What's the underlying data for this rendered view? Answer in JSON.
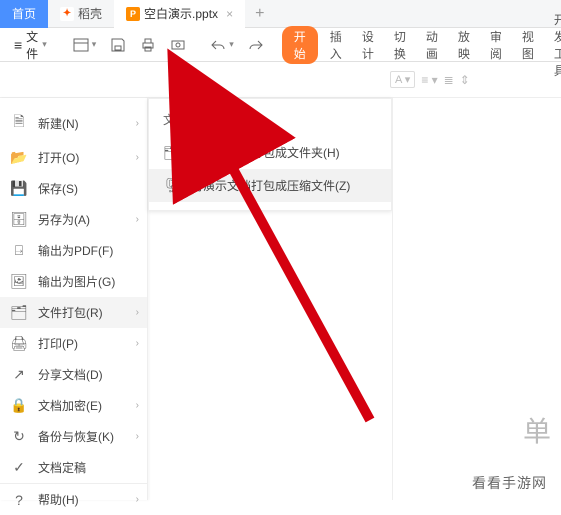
{
  "tabs": {
    "home": "首页",
    "dk": "稻壳",
    "doc": "空白演示.pptx"
  },
  "toolbar": {
    "file": "文件",
    "start_pill": "开始",
    "ribbon": [
      "插入",
      "设计",
      "切换",
      "动画",
      "放映",
      "审阅",
      "视图",
      "开发工具"
    ]
  },
  "file_menu": {
    "items": [
      {
        "label": "新建(N)",
        "icon": "new",
        "arrow": true
      },
      {
        "label": "打开(O)",
        "icon": "open",
        "arrow": true
      },
      {
        "label": "保存(S)",
        "icon": "save",
        "arrow": false
      },
      {
        "label": "另存为(A)",
        "icon": "saveas",
        "arrow": true
      },
      {
        "label": "输出为PDF(F)",
        "icon": "pdf",
        "arrow": false
      },
      {
        "label": "输出为图片(G)",
        "icon": "img",
        "arrow": false
      },
      {
        "label": "文件打包(R)",
        "icon": "pack",
        "arrow": true,
        "highlight": true
      },
      {
        "label": "打印(P)",
        "icon": "print",
        "arrow": true
      },
      {
        "label": "分享文档(D)",
        "icon": "share",
        "arrow": false
      },
      {
        "label": "文档加密(E)",
        "icon": "lock",
        "arrow": true
      },
      {
        "label": "备份与恢复(K)",
        "icon": "backup",
        "arrow": true
      },
      {
        "label": "文档定稿",
        "icon": "final",
        "arrow": false
      }
    ],
    "help": "帮助(H)"
  },
  "submenu": {
    "title": "文件打包",
    "items": [
      {
        "label": "将演示文档打包成文件夹(H)",
        "hover": false
      },
      {
        "label": "将演示文档打包成压缩文件(Z)",
        "hover": true
      }
    ]
  },
  "format_hint_a": "A",
  "canvas_placeholder": "单",
  "watermark": "看看手游网"
}
